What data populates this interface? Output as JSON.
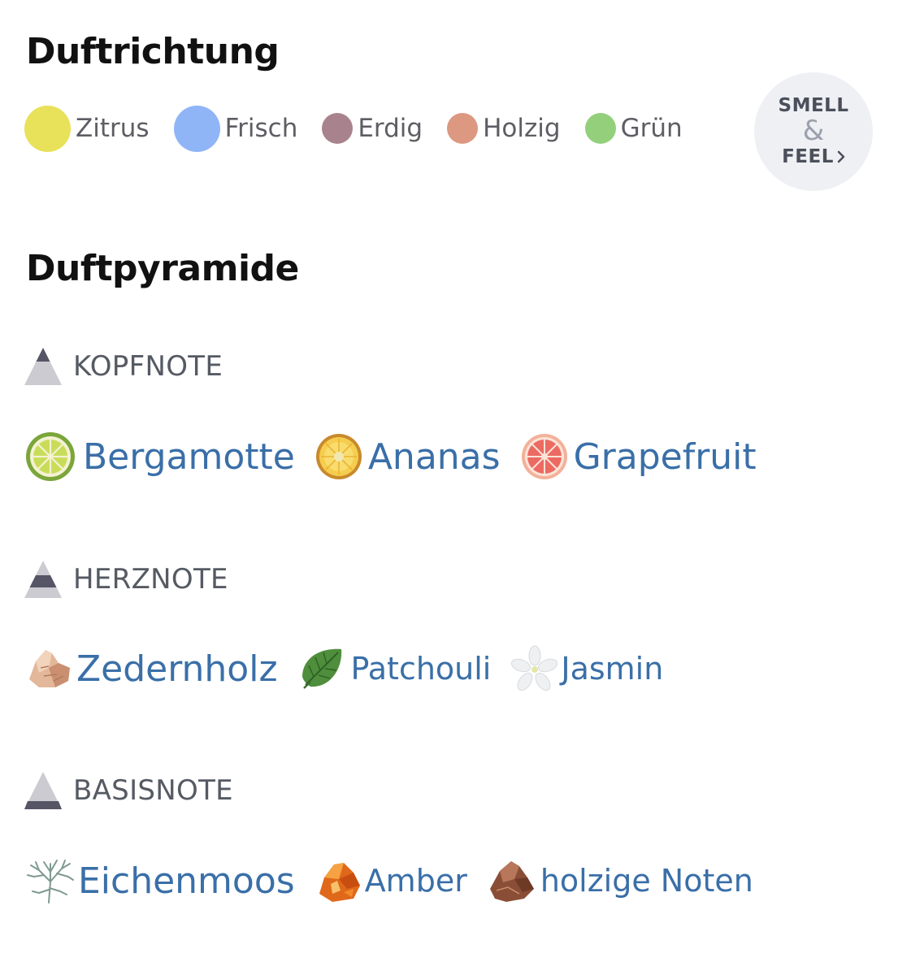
{
  "scent_direction": {
    "title": "Duftrichtung",
    "items": [
      {
        "label": "Zitrus",
        "color": "#e8e15a"
      },
      {
        "label": "Frisch",
        "color": "#8fb5f7"
      },
      {
        "label": "Erdig",
        "color": "#a8838e"
      },
      {
        "label": "Holzig",
        "color": "#dc9880"
      },
      {
        "label": "Grün",
        "color": "#94d07c"
      }
    ],
    "smell_feel": {
      "line1": "SMELL",
      "amp": "&",
      "line2": "FEEL"
    }
  },
  "pyramid": {
    "title": "Duftpyramide",
    "top": {
      "label": "KOPFNOTE",
      "ingredients": [
        {
          "name": "Bergamotte",
          "icon": "bergamot-icon"
        },
        {
          "name": "Ananas",
          "icon": "pineapple-icon"
        },
        {
          "name": "Grapefruit",
          "icon": "grapefruit-icon"
        }
      ]
    },
    "heart": {
      "label": "HERZNOTE",
      "ingredients": [
        {
          "name": "Zedernholz",
          "icon": "cedarwood-icon"
        },
        {
          "name": "Patchouli",
          "icon": "patchouli-leaf-icon"
        },
        {
          "name": "Jasmin",
          "icon": "jasmine-flower-icon"
        }
      ]
    },
    "base": {
      "label": "BASISNOTE",
      "ingredients": [
        {
          "name": "Eichenmoos",
          "icon": "oakmoss-icon"
        },
        {
          "name": "Amber",
          "icon": "amber-icon"
        },
        {
          "name": "holzige Noten",
          "icon": "woody-notes-icon"
        }
      ]
    }
  }
}
